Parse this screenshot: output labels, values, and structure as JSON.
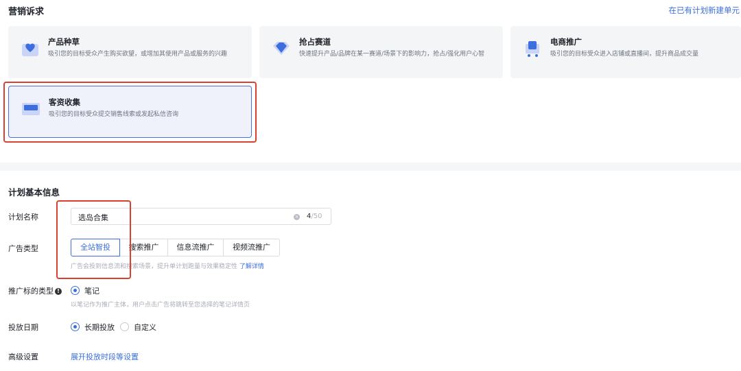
{
  "marketing": {
    "title": "营销诉求",
    "new_link": "在已有计划新建单元",
    "cards": [
      {
        "title": "产品种草",
        "desc": "吸引您的目标受众产生购买欲望，或增加其使用产品或服务的兴趣",
        "icon": "heart-box-icon"
      },
      {
        "title": "抢占赛道",
        "desc": "快速提升产品/品牌在某一赛道/场景下的影响力，抢占/强化用户心智",
        "icon": "diamond-icon"
      },
      {
        "title": "电商推广",
        "desc": "吸引您的目标受众进入店铺或直播间，提升商品成交量",
        "icon": "shopping-cart-icon"
      },
      {
        "title": "客资收集",
        "desc": "吸引您的目标受众提交销售线索或发起私信咨询",
        "icon": "card-icon"
      }
    ]
  },
  "plan": {
    "title": "计划基本信息",
    "name_label": "计划名称",
    "name_value": "选岛合集",
    "name_count": "4",
    "name_max": "/50",
    "ad_type_label": "广告类型",
    "ad_types": [
      "全站智投",
      "搜索推广",
      "信息流推广",
      "视频流推广"
    ],
    "ad_type_hint": "广告会投到信息流和搜索场景，提升单计划跑量与效果稳定性",
    "ad_type_hint_link": "了解详情",
    "target_label": "推广标的类型",
    "target_option": "笔记",
    "target_hint": "以笔记作为推广主体，用户点击广告将跳转至您选择的笔记详情页",
    "date_label": "投放日期",
    "date_options": [
      "长期投放",
      "自定义"
    ],
    "advanced_label": "高级设置",
    "advanced_link": "展开投放时段等设置"
  },
  "colors": {
    "accent": "#3b6fe0",
    "highlight": "#d8402f"
  }
}
